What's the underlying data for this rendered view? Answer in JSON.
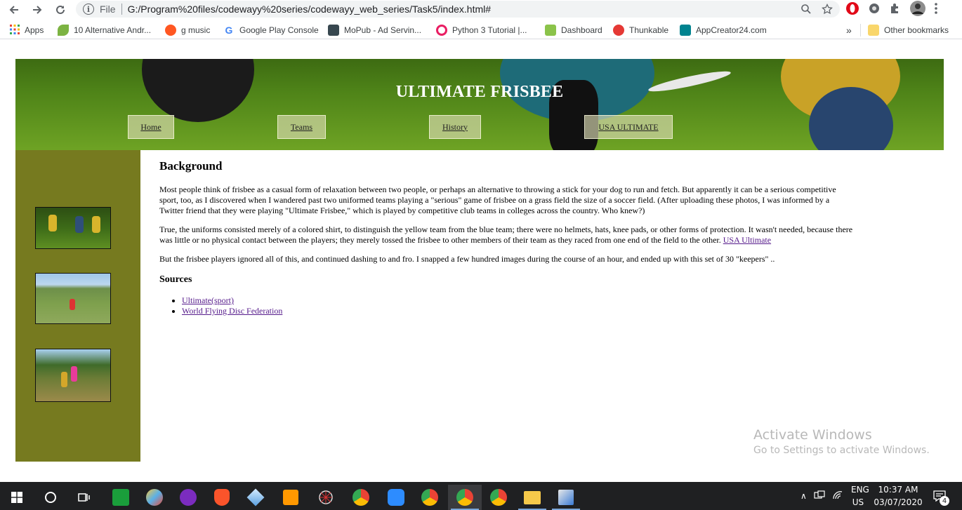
{
  "browser": {
    "url_scheme": "File",
    "url": "G:/Program%20files/codewayy%20series/codewayy_web_series/Task5/index.html#",
    "bookmarks": [
      {
        "label": "Apps",
        "color": "#ea4335"
      },
      {
        "label": "10 Alternative Andr...",
        "color": "#7cb342"
      },
      {
        "label": "g music",
        "color": "#ff5722"
      },
      {
        "label": "Google Play Console",
        "color": "#4285f4"
      },
      {
        "label": "MoPub - Ad Servin...",
        "color": "#37474f"
      },
      {
        "label": "Python 3 Tutorial |...",
        "color": "#e91e63"
      },
      {
        "label": "Dashboard",
        "color": "#8bc34a"
      },
      {
        "label": "Thunkable",
        "color": "#e53935"
      },
      {
        "label": "AppCreator24.com",
        "color": "#00838f"
      }
    ],
    "more_bookmarks": "»",
    "other_bookmarks": "Other bookmarks"
  },
  "site": {
    "title": "ULTIMATE FRISBEE",
    "nav": [
      "Home",
      "Teams",
      "History",
      "USA ULTIMATE"
    ]
  },
  "content": {
    "heading": "Background",
    "para1": "Most people think of frisbee as a casual form of relaxation between two people, or perhaps an alternative to throwing a stick for your dog to run and fetch. But apparently it can be a serious competitive sport, too, as I discovered when I wandered past two uniformed teams playing a \"serious\" game of frisbee on a grass field the size of a soccer field. (After uploading these photos, I was informed by a Twitter friend that they were playing \"Ultimate Frisbee,\" which is played by competitive club teams in colleges across the country. Who knew?)",
    "para2": "True, the uniforms consisted merely of a colored shirt, to distinguish the yellow team from the blue team; there were no helmets, hats, knee pads, or other forms of protection. It wasn't needed, because there was little or no physical contact between the players; they merely tossed the frisbee to other members of their team as they raced from one end of the field to the other.",
    "para2_link": "USA Ultimate",
    "para3": "But the frisbee players ignored all of this, and continued dashing to and fro. I snapped a few hundred images during the course of an hour, and ended up with this set of 30 \"keepers\" ..",
    "sources_heading": "Sources",
    "sources": [
      "Ultimate(sport)",
      "World Flying Disc Federation"
    ]
  },
  "watermark": {
    "line1": "Activate Windows",
    "line2": "Go to Settings to activate Windows."
  },
  "taskbar": {
    "lang": "ENG",
    "region": "US",
    "time": "10:37 AM",
    "date": "03/07/2020",
    "notifications": "4"
  },
  "colors": {
    "sidebar": "#767a1f",
    "link_visited": "#551a8b"
  }
}
